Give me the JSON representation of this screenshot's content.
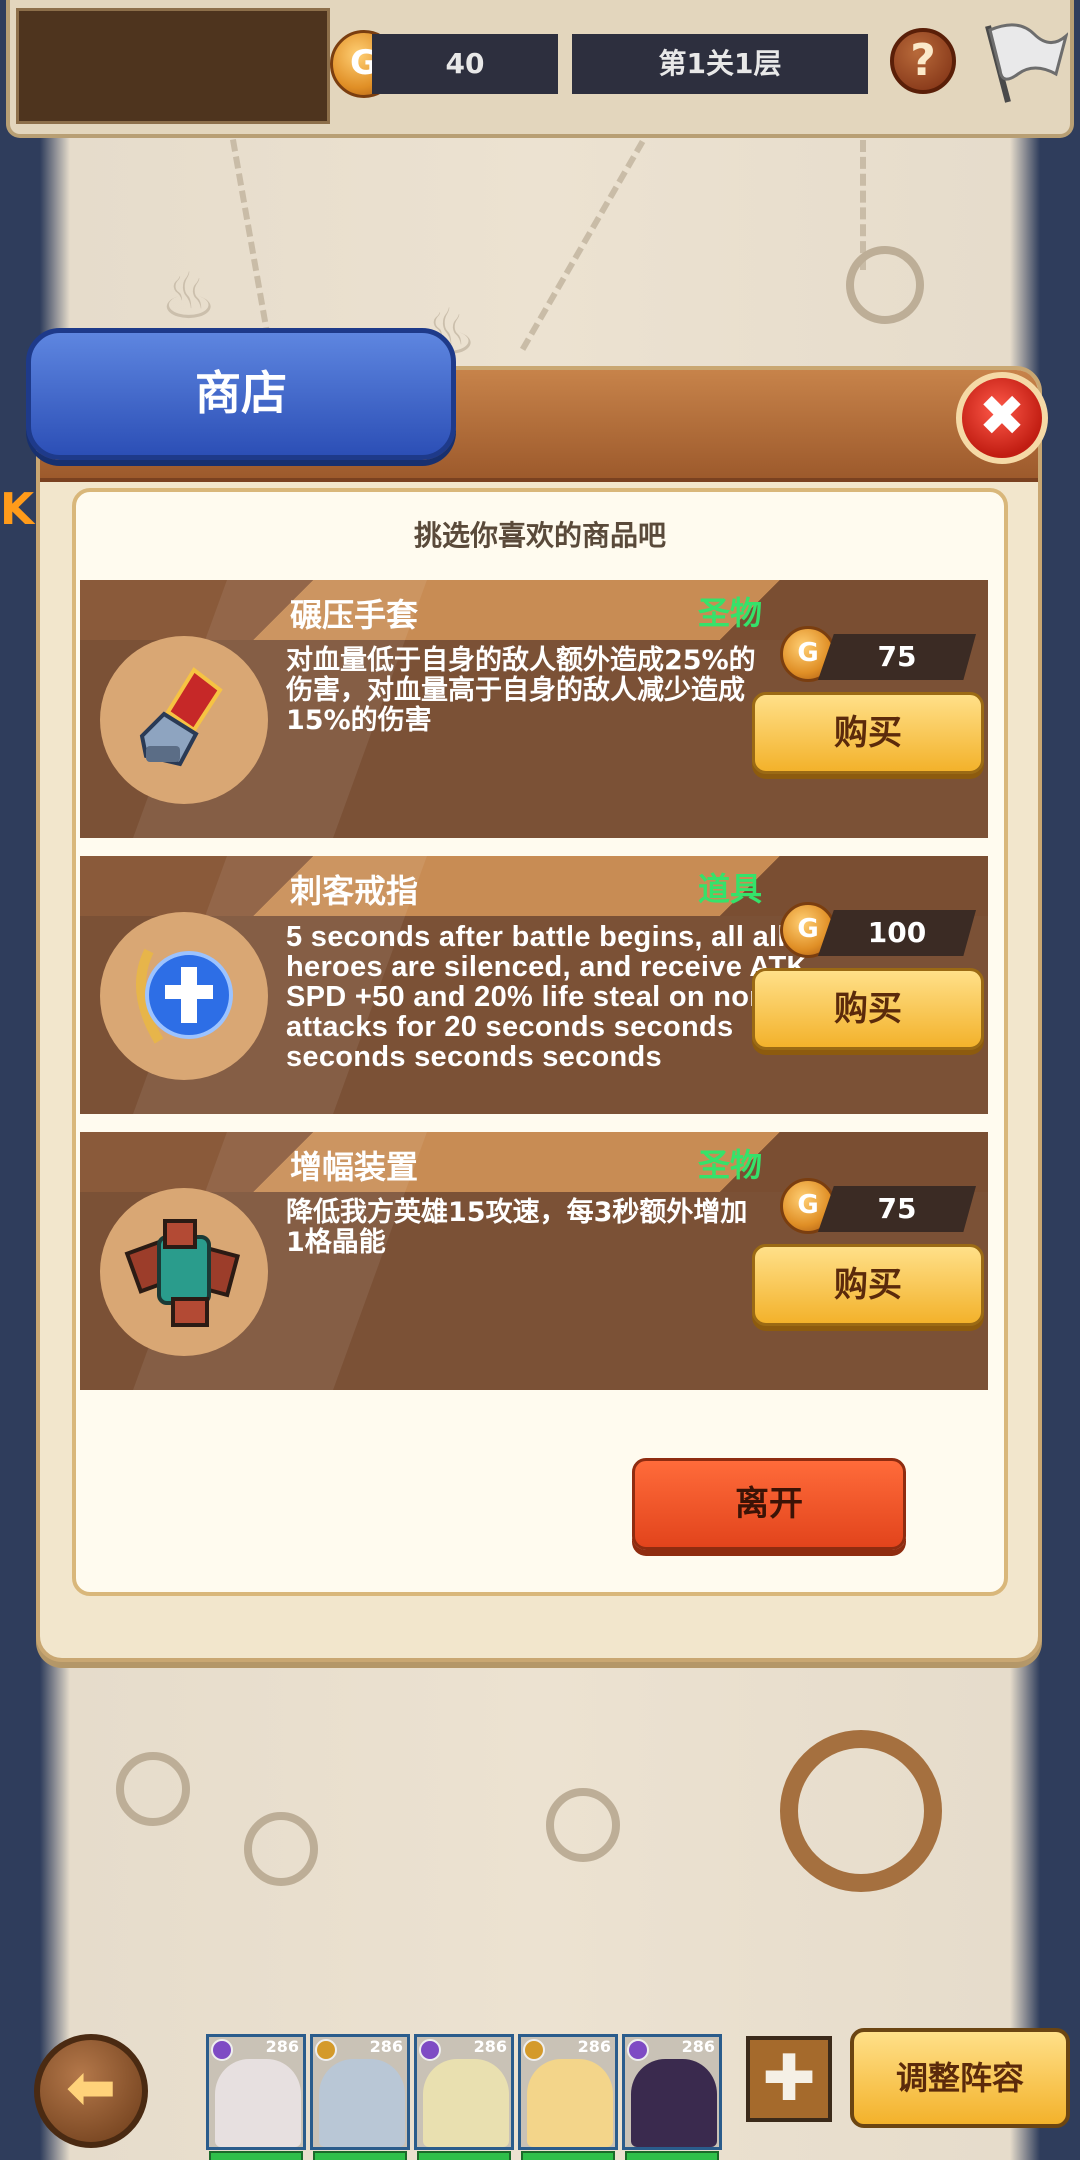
{
  "top_bar": {
    "coin_amount": "40",
    "level_label": "第1关1层",
    "help_label": "?"
  },
  "side_tag": "KD",
  "shop": {
    "title": "商店",
    "close_label": "✖",
    "subtitle": "挑选你喜欢的商品吧",
    "items": [
      {
        "name": "碾压手套",
        "type": "圣物",
        "description": "对血量低于自身的敌人额外造成25%的伤害，对血量高于自身的敌人减少造成15%的伤害",
        "price": "75",
        "buy_label": "购买",
        "icon": "gauntlet-icon"
      },
      {
        "name": "刺客戒指",
        "type": "道具",
        "description": "5 seconds after battle begins, all allied heroes are silenced, and receive ATK SPD +50 and 20% life steal on normal attacks for 20 seconds seconds seconds seconds seconds",
        "price": "100",
        "buy_label": "购买",
        "icon": "blue-cross-orb-icon"
      },
      {
        "name": "增幅装置",
        "type": "圣物",
        "description": "降低我方英雄15攻速，每3秒额外增加1格晶能",
        "price": "75",
        "buy_label": "购买",
        "icon": "amplifier-device-icon"
      }
    ],
    "leave_label": "离开"
  },
  "bottom_bar": {
    "back_icon": "back-arrow-icon",
    "heroes": [
      {
        "level": "286",
        "portrait_color": "#e7e0e0"
      },
      {
        "level": "286",
        "portrait_color": "#b9c7d6"
      },
      {
        "level": "286",
        "portrait_color": "#e9e0b0"
      },
      {
        "level": "286",
        "portrait_color": "#f3d58a"
      },
      {
        "level": "286",
        "portrait_color": "#3a2a4e"
      }
    ],
    "add_slot_icon": "add-hero-icon",
    "adjust_team_label": "调整阵容"
  },
  "colors": {
    "accent_blue": "#2c4fb6",
    "buy_gold": "#f3b22b",
    "leave_orange": "#e2441c",
    "type_green": "#35e26a"
  }
}
